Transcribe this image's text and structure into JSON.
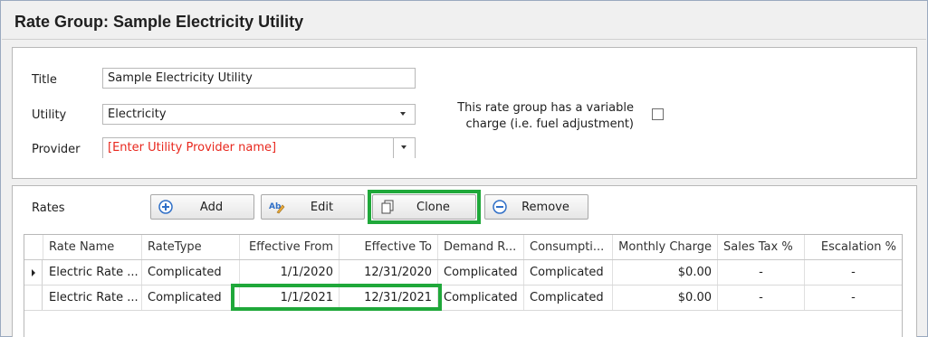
{
  "window": {
    "title": "Rate Group: Sample Electricity Utility"
  },
  "form": {
    "title_label": "Title",
    "title_value": "Sample Electricity Utility",
    "utility_label": "Utility",
    "utility_value": "Electricity",
    "provider_label": "Provider",
    "provider_placeholder": "[Enter Utility Provider name]",
    "variable_charge_line1": "This rate group has a variable",
    "variable_charge_line2": "charge (i.e. fuel adjustment)",
    "variable_charge_checked": false
  },
  "rates": {
    "label": "Rates",
    "buttons": {
      "add": "Add",
      "edit": "Edit",
      "clone": "Clone",
      "remove": "Remove"
    },
    "columns": [
      "Rate Name",
      "RateType",
      "Effective From",
      "Effective To",
      "Demand R...",
      "Consumpti...",
      "Monthly Charge",
      "Sales Tax %",
      "Escalation %"
    ],
    "rows": [
      {
        "name": "Electric Rate ...",
        "type": "Complicated",
        "from": "1/1/2020",
        "to": "12/31/2020",
        "demand": "Complicated",
        "consumption": "Complicated",
        "monthly": "$0.00",
        "sales_tax": "-",
        "escalation": "-",
        "current": true
      },
      {
        "name": "Electric Rate ...",
        "type": "Complicated",
        "from": "1/1/2021",
        "to": "12/31/2021",
        "demand": "Complicated",
        "consumption": "Complicated",
        "monthly": "$0.00",
        "sales_tax": "-",
        "escalation": "-",
        "current": false
      }
    ]
  },
  "colors": {
    "highlight": "#1fa83a",
    "placeholder": "#e8271d",
    "icon_blue": "#2f6fc7"
  },
  "icons": [
    "add-circle-icon",
    "edit-text-icon",
    "clone-copy-icon",
    "remove-circle-icon",
    "row-indicator-icon",
    "chevron-down-icon"
  ]
}
